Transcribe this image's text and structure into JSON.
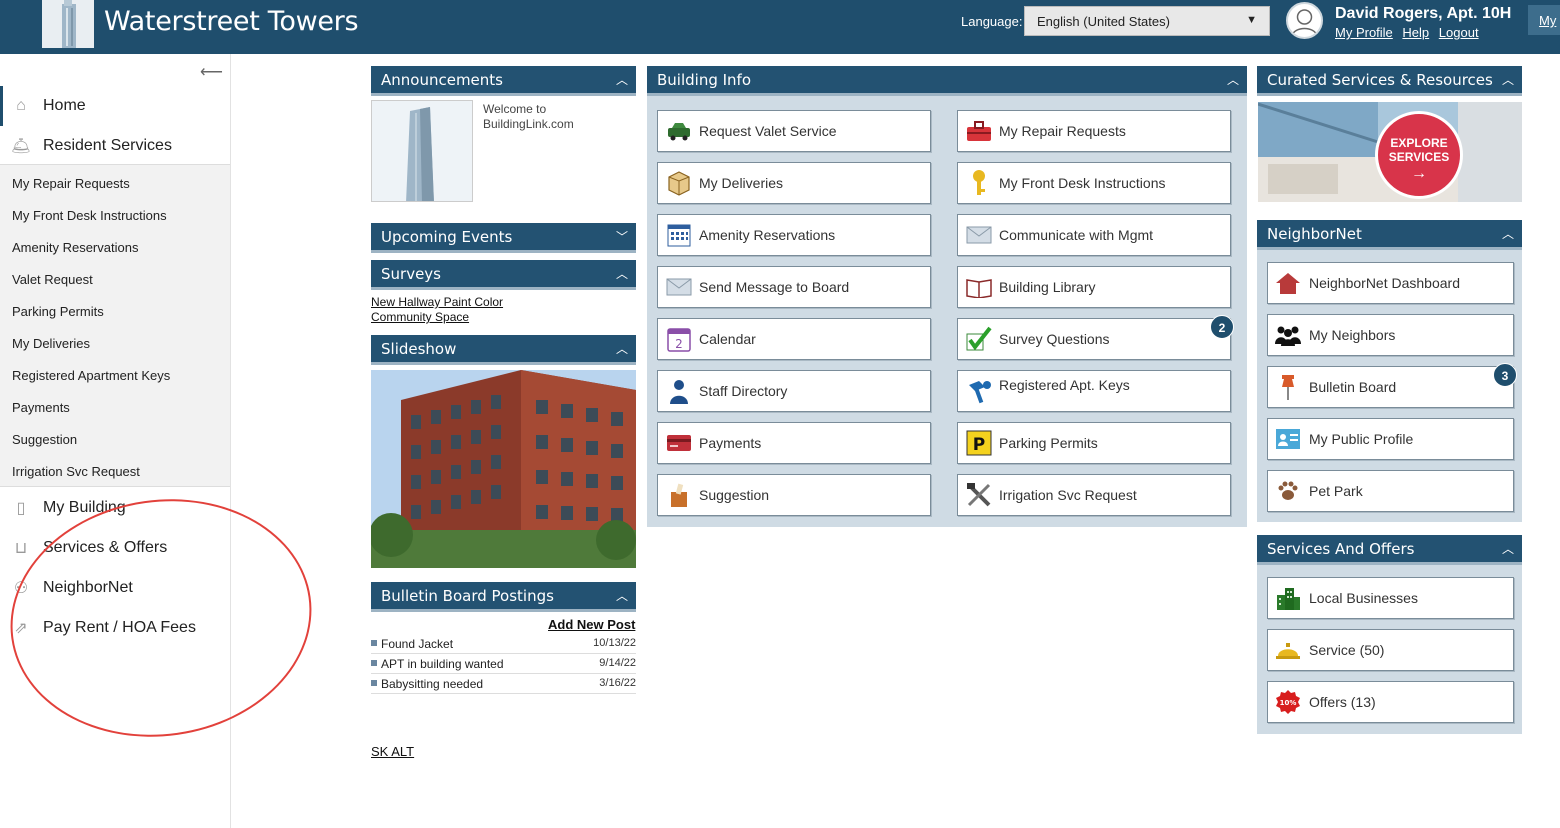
{
  "header": {
    "title": "Waterstreet Towers",
    "language_label": "Language:",
    "language_value": "English (United States)",
    "user_name": "David Rogers, Apt. 10H",
    "links": [
      "My Profile",
      "Help",
      "Logout"
    ],
    "my_tab": "My"
  },
  "sidebar": {
    "top": [
      {
        "label": "Home",
        "icon": "home-icon"
      },
      {
        "label": "Resident Services",
        "icon": "concierge-bell-icon"
      }
    ],
    "sub": [
      "My Repair Requests",
      "My Front Desk Instructions",
      "Amenity Reservations",
      "Valet Request",
      "Parking Permits",
      "My Deliveries",
      "Registered Apartment Keys",
      "Payments",
      "Suggestion",
      "Irrigation Svc Request"
    ],
    "bottom": [
      {
        "label": "My Building",
        "icon": "building-icon"
      },
      {
        "label": "Services & Offers",
        "icon": "basket-icon"
      },
      {
        "label": "NeighborNet",
        "icon": "people-icon"
      },
      {
        "label": "Pay Rent / HOA Fees",
        "icon": "pay-icon"
      }
    ]
  },
  "announcements": {
    "title": "Announcements",
    "text": "Welcome to BuildingLink.com"
  },
  "upcoming_events": {
    "title": "Upcoming Events"
  },
  "surveys": {
    "title": "Surveys",
    "links": [
      "New Hallway Paint Color",
      "Community Space"
    ]
  },
  "slideshow": {
    "title": "Slideshow"
  },
  "bulletin": {
    "title": "Bulletin Board Postings",
    "add": "Add New Post",
    "posts": [
      {
        "title": "Found Jacket",
        "date": "10/13/22"
      },
      {
        "title": "APT in building wanted",
        "date": "9/14/22"
      },
      {
        "title": "Babysitting needed",
        "date": "3/16/22"
      }
    ]
  },
  "footer_link": "SK ALT",
  "building_info": {
    "title": "Building Info",
    "left": [
      {
        "label": "Request Valet Service",
        "icon": "car-icon"
      },
      {
        "label": "My Deliveries",
        "icon": "package-icon"
      },
      {
        "label": "Amenity Reservations",
        "icon": "calendar-grid-icon"
      },
      {
        "label": "Send Message to Board",
        "icon": "envelope-icon"
      },
      {
        "label": "Calendar",
        "icon": "calendar-icon"
      },
      {
        "label": "Staff Directory",
        "icon": "staff-icon"
      },
      {
        "label": "Payments",
        "icon": "credit-card-icon"
      },
      {
        "label": "Suggestion",
        "icon": "suggestion-box-icon"
      }
    ],
    "right": [
      {
        "label": "My Repair Requests",
        "icon": "toolbox-icon"
      },
      {
        "label": "My Front Desk Instructions",
        "icon": "key-icon"
      },
      {
        "label": "Communicate with Mgmt",
        "icon": "envelope-icon"
      },
      {
        "label": "Building Library",
        "icon": "book-icon"
      },
      {
        "label": "Survey Questions",
        "icon": "checkmark-icon",
        "badge": "2"
      },
      {
        "label": "Registered Apt. Keys",
        "icon": "key-tag-icon"
      },
      {
        "label": "Parking Permits",
        "icon": "parking-icon"
      },
      {
        "label": "Irrigation Svc Request",
        "icon": "tools-icon"
      }
    ]
  },
  "curated": {
    "title": "Curated Services & Resources",
    "explore_line1": "EXPLORE",
    "explore_line2": "SERVICES"
  },
  "neighbornet": {
    "title": "NeighborNet",
    "items": [
      {
        "label": "NeighborNet Dashboard",
        "icon": "house-icon"
      },
      {
        "label": "My Neighbors",
        "icon": "neighbors-icon"
      },
      {
        "label": "Bulletin Board",
        "icon": "pushpin-icon",
        "badge": "3"
      },
      {
        "label": "My Public Profile",
        "icon": "profile-card-icon"
      },
      {
        "label": "Pet Park",
        "icon": "paw-icon"
      }
    ]
  },
  "services_offers": {
    "title": "Services And Offers",
    "items": [
      {
        "label": "Local Businesses",
        "icon": "city-icon"
      },
      {
        "label": "Service (50)",
        "icon": "service-bell-icon"
      },
      {
        "label": "Offers (13)",
        "icon": "discount-icon",
        "discount": "10%"
      }
    ]
  },
  "colors": {
    "header": "#1f4e6d",
    "panel": "#235272",
    "tile_bg": "#cfdbe4",
    "annotation": "#e2413b"
  }
}
